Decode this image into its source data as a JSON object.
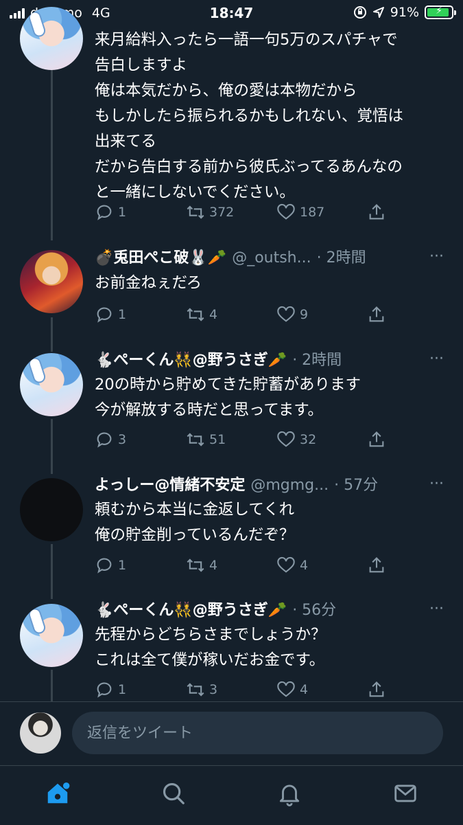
{
  "status_bar": {
    "carrier": "docomo",
    "network": "4G",
    "time": "18:47",
    "battery": "91%",
    "battery_level": 0.91
  },
  "tweets": [
    {
      "text": "来月給料入ったら一語一句5万のスパチャで\n告白しますよ\n俺は本気だから、俺の愛は本物だから\nもしかしたら振られるかもしれない、覚悟は\n出来てる\nだから告白する前から彼氏ぶってるあんなの\nと一緒にしないでください。",
      "replies": "1",
      "retweets": "372",
      "likes": "187"
    },
    {
      "name": "💣兎田ぺこ破🐰🥕",
      "handle": "@_outsh...",
      "time": "· 2時間",
      "text": "お前金ねぇだろ",
      "replies": "1",
      "retweets": "4",
      "likes": "9"
    },
    {
      "name": "🐇ぺーくん👯@野うさぎ🥕",
      "handle": "",
      "time": "· 2時間",
      "text": "20の時から貯めてきた貯蓄があります\n今が解放する時だと思ってます。",
      "replies": "3",
      "retweets": "51",
      "likes": "32"
    },
    {
      "name": "よっしー@情緒不安定",
      "handle": "@mgmg...",
      "time": "· 57分",
      "text": "頼むから本当に金返してくれ\n俺の貯金削っているんだぞ？",
      "replies": "1",
      "retweets": "4",
      "likes": "4"
    },
    {
      "name": "🐇ぺーくん👯@野うさぎ🥕",
      "handle": "",
      "time": "· 56分",
      "text": "先程からどちらさまでしょうか？\nこれは全て僕が稼いだお金です。",
      "replies": "1",
      "retweets": "3",
      "likes": "4"
    }
  ],
  "more_icon": "···",
  "reply_box": {
    "placeholder": "返信をツイート"
  },
  "tabs": [
    "home-icon",
    "search-icon",
    "notifications-icon",
    "messages-icon"
  ],
  "colors": {
    "background": "#15202b",
    "accent": "#1d9bf0",
    "muted": "#8899a6",
    "divider": "#38444d"
  }
}
